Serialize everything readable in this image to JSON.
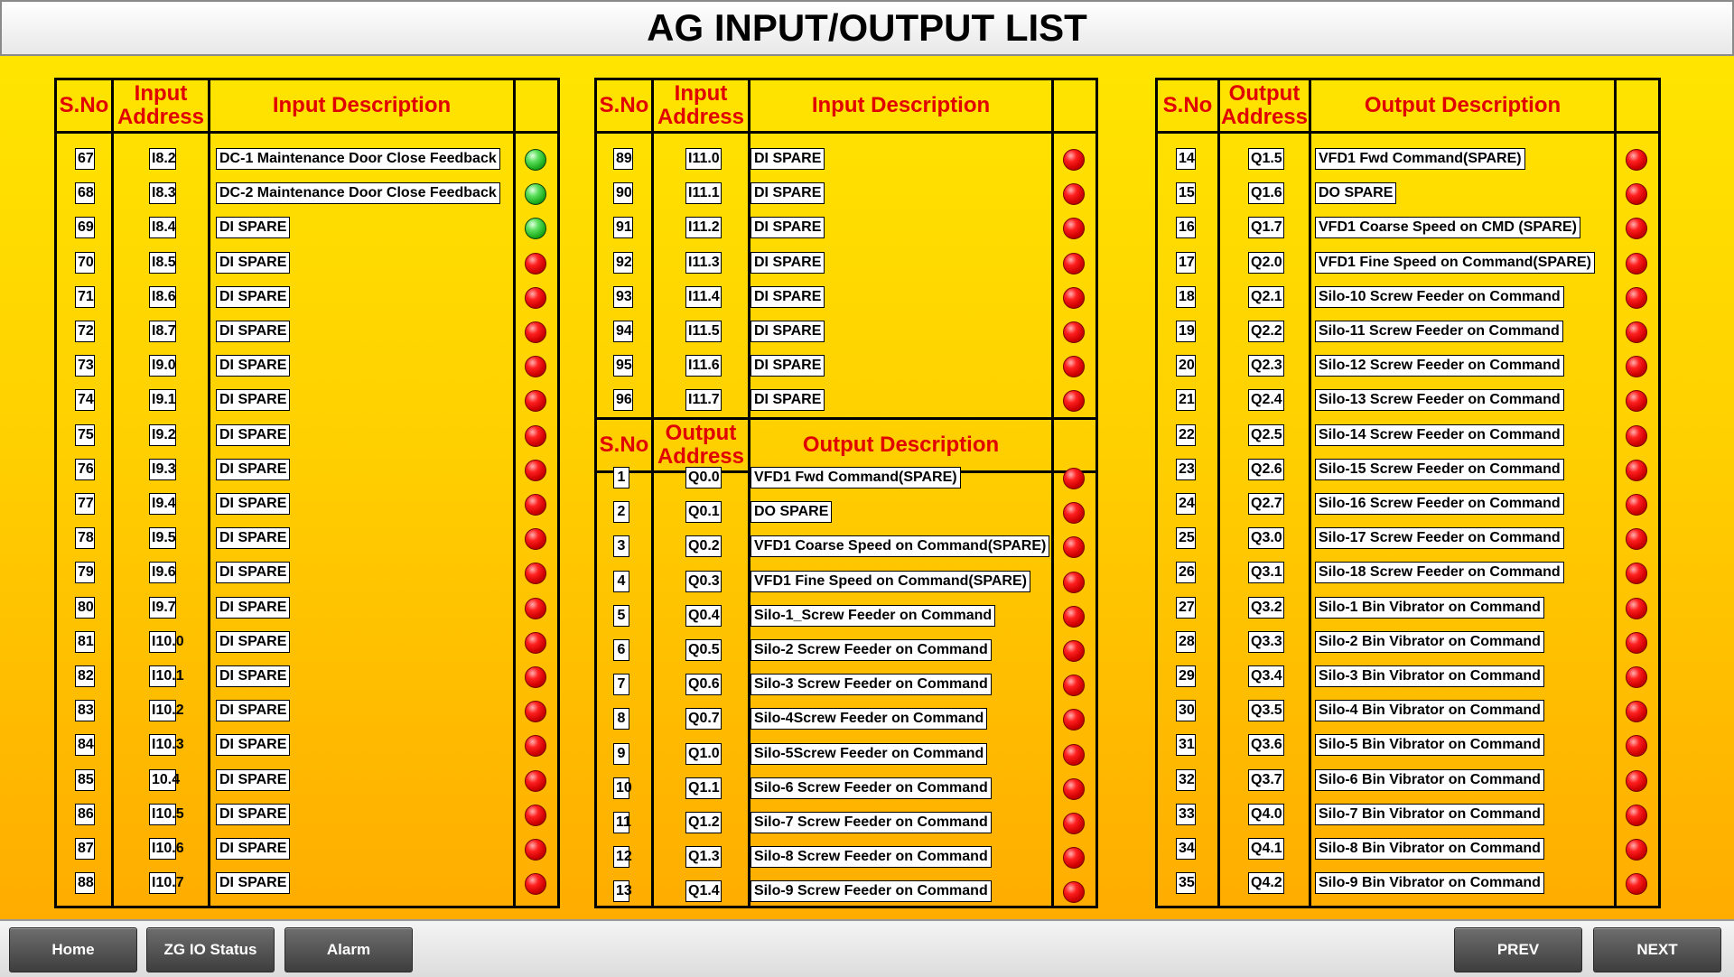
{
  "title": "AG INPUT/OUTPUT LIST",
  "headers": {
    "sno": "S.No",
    "input_address": "Input\nAddress",
    "input_description": "Input Description",
    "output_address": "Output\nAddress",
    "output_description": "Output Description"
  },
  "colors": {
    "accent_red": "#e00000",
    "led_on": "green",
    "led_off": "red"
  },
  "panel1_rows": [
    {
      "sno": "67",
      "addr": "I8.2",
      "desc": "DC-1 Maintenance Door Close Feedback",
      "state": "green"
    },
    {
      "sno": "68",
      "addr": "I8.3",
      "desc": "DC-2 Maintenance Door Close Feedback",
      "state": "green"
    },
    {
      "sno": "69",
      "addr": "I8.4",
      "desc": "DI SPARE",
      "state": "green"
    },
    {
      "sno": "70",
      "addr": "I8.5",
      "desc": "DI SPARE",
      "state": "red"
    },
    {
      "sno": "71",
      "addr": "I8.6",
      "desc": "DI SPARE",
      "state": "red"
    },
    {
      "sno": "72",
      "addr": "I8.7",
      "desc": "DI SPARE",
      "state": "red"
    },
    {
      "sno": "73",
      "addr": "I9.0",
      "desc": "DI SPARE",
      "state": "red"
    },
    {
      "sno": "74",
      "addr": "I9.1",
      "desc": "DI SPARE",
      "state": "red"
    },
    {
      "sno": "75",
      "addr": "I9.2",
      "desc": "DI SPARE",
      "state": "red"
    },
    {
      "sno": "76",
      "addr": "I9.3",
      "desc": "DI SPARE",
      "state": "red"
    },
    {
      "sno": "77",
      "addr": "I9.4",
      "desc": "DI SPARE",
      "state": "red"
    },
    {
      "sno": "78",
      "addr": "I9.5",
      "desc": "DI SPARE",
      "state": "red"
    },
    {
      "sno": "79",
      "addr": "I9.6",
      "desc": "DI SPARE",
      "state": "red"
    },
    {
      "sno": "80",
      "addr": "I9.7",
      "desc": "DI SPARE",
      "state": "red"
    },
    {
      "sno": "81",
      "addr": "I10.0",
      "desc": "DI SPARE",
      "state": "red"
    },
    {
      "sno": "82",
      "addr": "I10.1",
      "desc": "DI SPARE",
      "state": "red"
    },
    {
      "sno": "83",
      "addr": "I10.2",
      "desc": "DI SPARE",
      "state": "red"
    },
    {
      "sno": "84",
      "addr": "I10.3",
      "desc": "DI SPARE",
      "state": "red"
    },
    {
      "sno": "85",
      "addr": "10.4",
      "desc": "DI SPARE",
      "state": "red"
    },
    {
      "sno": "86",
      "addr": "I10.5",
      "desc": "DI SPARE",
      "state": "red"
    },
    {
      "sno": "87",
      "addr": "I10.6",
      "desc": "DI SPARE",
      "state": "red"
    },
    {
      "sno": "88",
      "addr": "I10.7",
      "desc": "DI SPARE",
      "state": "red"
    }
  ],
  "panel2_input_rows": [
    {
      "sno": "89",
      "addr": "I11.0",
      "desc": "DI SPARE",
      "state": "red"
    },
    {
      "sno": "90",
      "addr": "I11.1",
      "desc": "DI SPARE",
      "state": "red"
    },
    {
      "sno": "91",
      "addr": "I11.2",
      "desc": "DI SPARE",
      "state": "red"
    },
    {
      "sno": "92",
      "addr": "I11.3",
      "desc": "DI SPARE",
      "state": "red"
    },
    {
      "sno": "93",
      "addr": "I11.4",
      "desc": "DI SPARE",
      "state": "red"
    },
    {
      "sno": "94",
      "addr": "I11.5",
      "desc": "DI SPARE",
      "state": "red"
    },
    {
      "sno": "95",
      "addr": "I11.6",
      "desc": "DI SPARE",
      "state": "red"
    },
    {
      "sno": "96",
      "addr": "I11.7",
      "desc": "DI SPARE",
      "state": "red"
    }
  ],
  "panel2_output_rows": [
    {
      "sno": "1",
      "addr": "Q0.0",
      "desc": "VFD1 Fwd Command(SPARE)",
      "state": "red"
    },
    {
      "sno": "2",
      "addr": "Q0.1",
      "desc": "DO SPARE",
      "state": "red"
    },
    {
      "sno": "3",
      "addr": "Q0.2",
      "desc": "VFD1 Coarse Speed on Command(SPARE)",
      "state": "red"
    },
    {
      "sno": "4",
      "addr": "Q0.3",
      "desc": "VFD1 Fine Speed on Command(SPARE)",
      "state": "red"
    },
    {
      "sno": "5",
      "addr": "Q0.4",
      "desc": "Silo-1_Screw Feeder on Command",
      "state": "red"
    },
    {
      "sno": "6",
      "addr": "Q0.5",
      "desc": "Silo-2 Screw Feeder on Command",
      "state": "red"
    },
    {
      "sno": "7",
      "addr": "Q0.6",
      "desc": "Silo-3 Screw Feeder on Command",
      "state": "red"
    },
    {
      "sno": "8",
      "addr": "Q0.7",
      "desc": "Silo-4Screw Feeder on Command",
      "state": "red"
    },
    {
      "sno": "9",
      "addr": "Q1.0",
      "desc": "Silo-5Screw Feeder on Command",
      "state": "red"
    },
    {
      "sno": "10",
      "addr": "Q1.1",
      "desc": "Silo-6 Screw Feeder on Command",
      "state": "red"
    },
    {
      "sno": "11",
      "addr": "Q1.2",
      "desc": "Silo-7 Screw Feeder on Command",
      "state": "red"
    },
    {
      "sno": "12",
      "addr": "Q1.3",
      "desc": "Silo-8 Screw Feeder on Command",
      "state": "red"
    },
    {
      "sno": "13",
      "addr": "Q1.4",
      "desc": "Silo-9 Screw Feeder on Command",
      "state": "red"
    }
  ],
  "panel3_rows": [
    {
      "sno": "14",
      "addr": "Q1.5",
      "desc": "VFD1 Fwd Command(SPARE)",
      "state": "red"
    },
    {
      "sno": "15",
      "addr": "Q1.6",
      "desc": "DO SPARE",
      "state": "red"
    },
    {
      "sno": "16",
      "addr": "Q1.7",
      "desc": "VFD1 Coarse Speed on CMD (SPARE)",
      "state": "red"
    },
    {
      "sno": "17",
      "addr": "Q2.0",
      "desc": "VFD1 Fine Speed on Command(SPARE)",
      "state": "red"
    },
    {
      "sno": "18",
      "addr": "Q2.1",
      "desc": "Silo-10 Screw Feeder on Command",
      "state": "red"
    },
    {
      "sno": "19",
      "addr": "Q2.2",
      "desc": "Silo-11 Screw Feeder on Command",
      "state": "red"
    },
    {
      "sno": "20",
      "addr": "Q2.3",
      "desc": "Silo-12 Screw Feeder on Command",
      "state": "red"
    },
    {
      "sno": "21",
      "addr": "Q2.4",
      "desc": "Silo-13 Screw Feeder on Command",
      "state": "red"
    },
    {
      "sno": "22",
      "addr": "Q2.5",
      "desc": "Silo-14 Screw Feeder on Command",
      "state": "red"
    },
    {
      "sno": "23",
      "addr": "Q2.6",
      "desc": "Silo-15 Screw Feeder on Command",
      "state": "red"
    },
    {
      "sno": "24",
      "addr": "Q2.7",
      "desc": "Silo-16 Screw Feeder on Command",
      "state": "red"
    },
    {
      "sno": "25",
      "addr": "Q3.0",
      "desc": "Silo-17 Screw Feeder on Command",
      "state": "red"
    },
    {
      "sno": "26",
      "addr": "Q3.1",
      "desc": "Silo-18 Screw Feeder on Command",
      "state": "red"
    },
    {
      "sno": "27",
      "addr": "Q3.2",
      "desc": "Silo-1 Bin Vibrator on Command",
      "state": "red"
    },
    {
      "sno": "28",
      "addr": "Q3.3",
      "desc": "Silo-2 Bin Vibrator on Command",
      "state": "red"
    },
    {
      "sno": "29",
      "addr": "Q3.4",
      "desc": "Silo-3 Bin Vibrator on Command",
      "state": "red"
    },
    {
      "sno": "30",
      "addr": "Q3.5",
      "desc": "Silo-4 Bin Vibrator on Command",
      "state": "red"
    },
    {
      "sno": "31",
      "addr": "Q3.6",
      "desc": "Silo-5 Bin Vibrator on Command",
      "state": "red"
    },
    {
      "sno": "32",
      "addr": "Q3.7",
      "desc": "Silo-6 Bin Vibrator on Command",
      "state": "red"
    },
    {
      "sno": "33",
      "addr": "Q4.0",
      "desc": "Silo-7 Bin Vibrator on Command",
      "state": "red"
    },
    {
      "sno": "34",
      "addr": "Q4.1",
      "desc": "Silo-8 Bin Vibrator on Command",
      "state": "red"
    },
    {
      "sno": "35",
      "addr": "Q4.2",
      "desc": "Silo-9 Bin Vibrator on Command",
      "state": "red"
    }
  ],
  "footer": {
    "home_label": "Home",
    "zg_io_label": "ZG IO Status",
    "alarm_label": "Alarm",
    "prev_label": "PREV",
    "next_label": "NEXT"
  }
}
